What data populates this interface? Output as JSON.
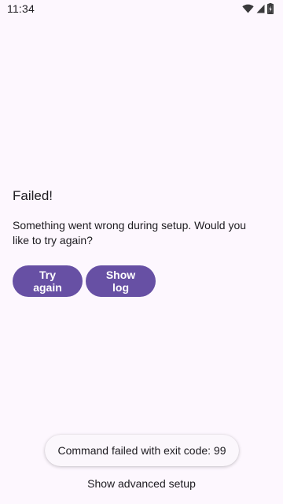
{
  "status_bar": {
    "time": "11:34",
    "icons": [
      "wifi-icon",
      "cell-signal-icon",
      "battery-charging-icon"
    ]
  },
  "main": {
    "title": "Failed!",
    "message": "Something went wrong during setup. Would you like to try again?",
    "try_again_label": "Try again",
    "show_log_label": "Show log"
  },
  "toast": {
    "text": "Command failed with exit code: 99"
  },
  "footer": {
    "advanced_label": "Show advanced setup"
  },
  "colors": {
    "background": "#fdf7fe",
    "primary": "#6750a4",
    "on_primary": "#ffffff",
    "text": "#1d1b20"
  }
}
